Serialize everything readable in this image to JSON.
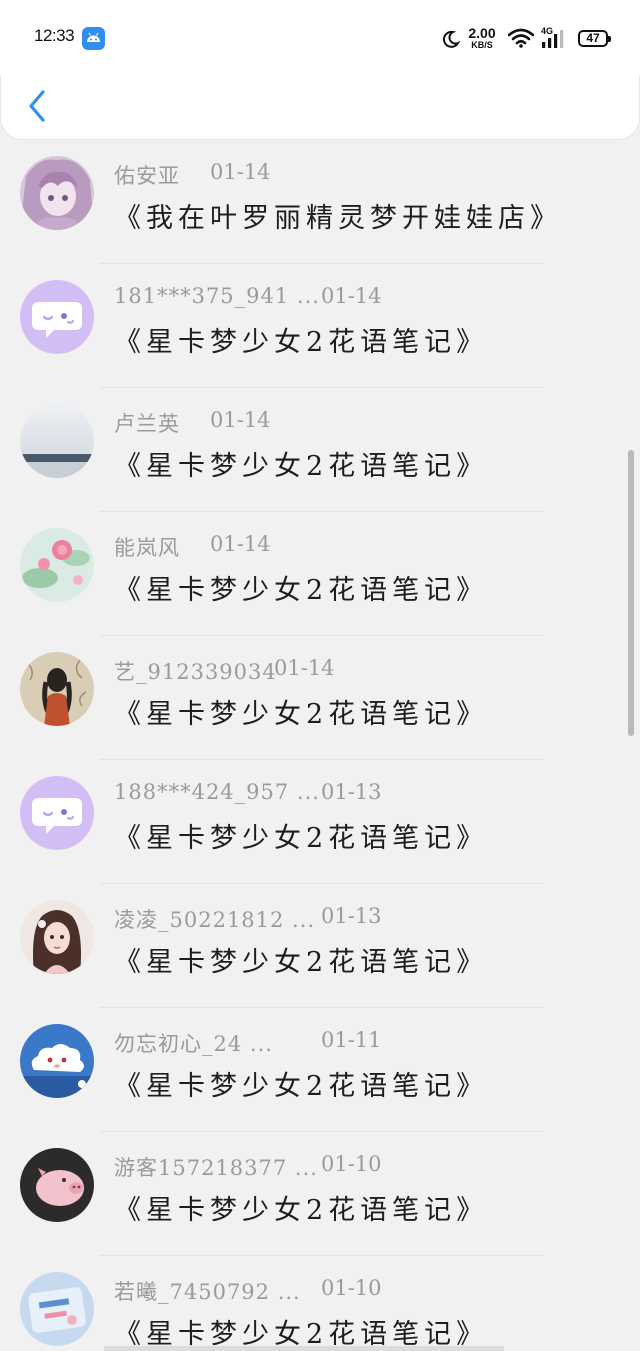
{
  "status_bar": {
    "time": "12:33",
    "speed_value": "2.00",
    "speed_unit": "KB/S",
    "network_type": "4G",
    "battery": "47"
  },
  "header": {
    "back_icon": "chevron-left-icon",
    "accent_color": "#2f8ff0"
  },
  "comments": [
    {
      "name": "佑安亚",
      "date": "01-14",
      "title": "《我在叶罗丽精灵梦开娃娃店》",
      "avatar": "anime-girl-purple"
    },
    {
      "name": "181***375_941 ...",
      "date": "01-14",
      "title": "《星卡梦少女2花语笔记》",
      "avatar": "default-chat-bubble"
    },
    {
      "name": "卢兰英",
      "date": "01-14",
      "title": "《星卡梦少女2花语笔记》",
      "avatar": "sea-horizon"
    },
    {
      "name": "能岚风",
      "date": "01-14",
      "title": "《星卡梦少女2花语笔记》",
      "avatar": "pink-flowers"
    },
    {
      "name": "艺_912339034",
      "date": "01-14",
      "title": "《星卡梦少女2花语笔记》",
      "avatar": "girl-from-behind"
    },
    {
      "name": "188***424_957 ...",
      "date": "01-13",
      "title": "《星卡梦少女2花语笔记》",
      "avatar": "default-chat-bubble"
    },
    {
      "name": "凌凌_50221812 ...",
      "date": "01-13",
      "title": "《星卡梦少女2花语笔记》",
      "avatar": "girl-portrait"
    },
    {
      "name": "勿忘初心_24 ...",
      "date": "01-11",
      "title": "《星卡梦少女2花语笔记》",
      "avatar": "cloud-character"
    },
    {
      "name": "游客157218377 ...",
      "date": "01-10",
      "title": "《星卡梦少女2花语笔记》",
      "avatar": "pink-pig"
    },
    {
      "name": "若曦_7450792 ...",
      "date": "01-10",
      "title": "《星卡梦少女2花语笔记》",
      "avatar": "blue-sticker"
    }
  ]
}
